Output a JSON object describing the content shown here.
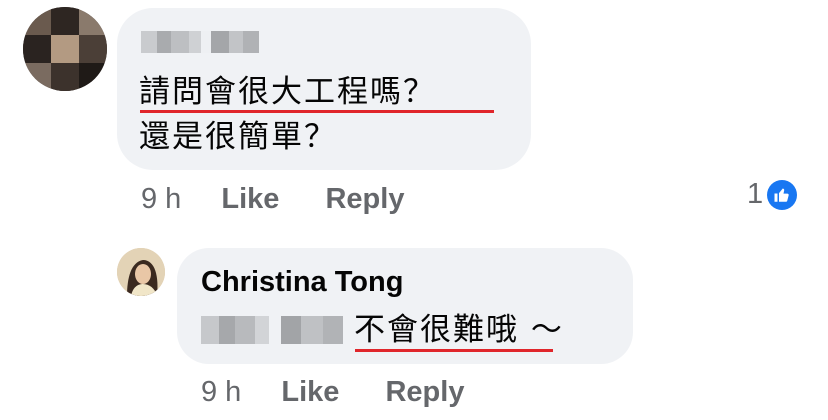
{
  "comment": {
    "lines": [
      "請問會很大工程嗎？",
      "還是很簡單？"
    ],
    "time": "9 h",
    "like_label": "Like",
    "reply_label": "Reply",
    "reaction_count": "1",
    "reaction_icon": "thumbs-up-icon",
    "reaction_color": "#1877f2"
  },
  "reply": {
    "author": "Christina Tong",
    "text": "不會很難哦 ～",
    "time": "9 h",
    "like_label": "Like",
    "reply_label": "Reply"
  }
}
